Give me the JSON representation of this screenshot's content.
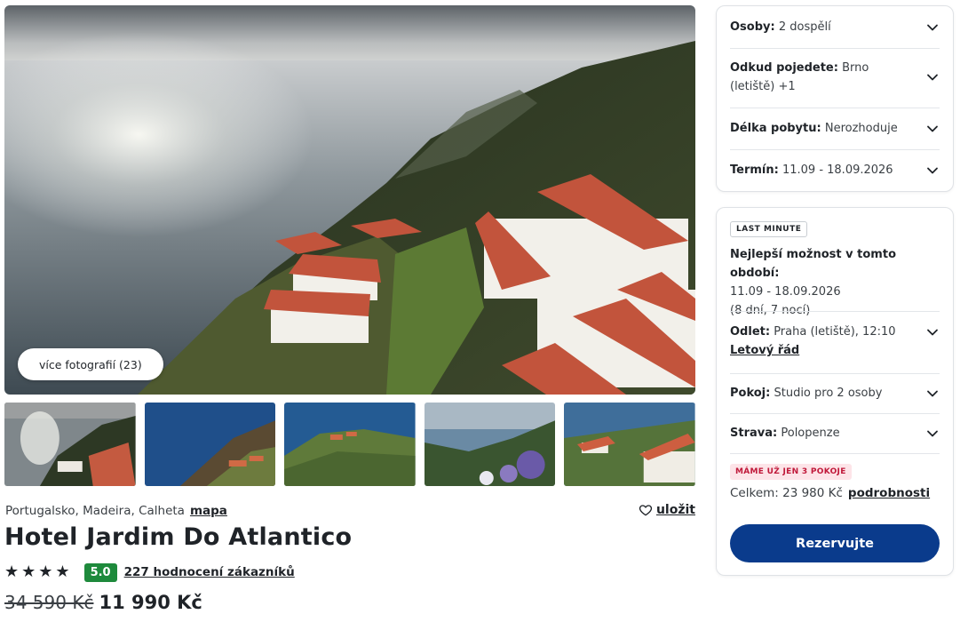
{
  "gallery": {
    "more_photos_label": "více fotografií (23)",
    "thumbnail_count": 5
  },
  "hotel": {
    "location": "Portugalsko, Madeira, Calheta",
    "map_link": "mapa",
    "save_label": "uložit",
    "name": "Hotel Jardim Do Atlantico",
    "stars": 4,
    "score": "5.0",
    "reviews": "227 hodnocení zákazníků",
    "old_price": "34 590 Kč",
    "new_price": "11 990 Kč"
  },
  "filters": {
    "persons_label": "Osoby:",
    "persons_value": "2 dospělí",
    "departure_label": "Odkud pojedete:",
    "departure_value": "Brno (letiště) +1",
    "length_label": "Délka pobytu:",
    "length_value": "Nerozhoduje",
    "term_label": "Termín:",
    "term_value": "11.09 - 18.09.2026"
  },
  "offer": {
    "badge": "LAST MINUTE",
    "best_label": "Nejlepší možnost v tomto období:",
    "best_dates": "11.09 - 18.09.2026",
    "best_nights": "(8 dní, 7 nocí)",
    "flight_label": "Odlet:",
    "flight_value": "Praha (letiště), 12:10",
    "flight_link": "Letový řád",
    "room_label": "Pokoj:",
    "room_value": "Studio pro 2 osoby",
    "board_label": "Strava:",
    "board_value": "Polopenze",
    "rooms_left": "MÁME UŽ JEN 3 POKOJE",
    "total_label": "Celkem: 23 980 Kč",
    "details_link": "podrobnosti",
    "reserve_label": "Rezervujte"
  },
  "colors": {
    "accent": "#0a3b8c",
    "score_green": "#1e8a3c",
    "alert_red": "#c0193a"
  }
}
